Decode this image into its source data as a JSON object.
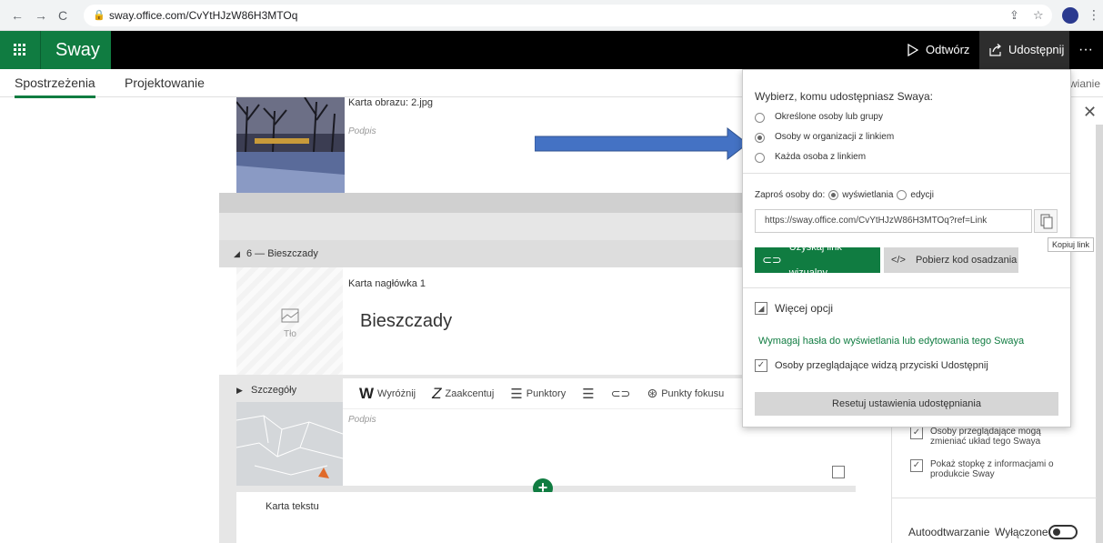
{
  "browser": {
    "url": "sway.office.com/CvYtHJzW86H3MTOq"
  },
  "app": {
    "name": "Sway",
    "play_label": "Odtwórz",
    "share_label": "Udostępnij",
    "more_label": "···"
  },
  "tabs": {
    "storyline": "Spostrzeżenia",
    "design": "Projektowanie",
    "right_partial": "wianie"
  },
  "cards": {
    "image_card_label": "Karta obrazu: 2.jpg",
    "image_caption": "Podpis",
    "section_title": "6 — Bieszczady",
    "heading_card_label": "Karta nagłówka 1",
    "heading_text": "Bieszczady",
    "bg_label": "Tło",
    "details_label": "Szczegóły",
    "map_caption": "Podpis",
    "text_card_label": "Karta tekstu"
  },
  "toolbar": {
    "emphasize": "Wyróżnij",
    "accent": "Zaakcentuj",
    "bullets": "Punktory",
    "focus": "Punkty fokusu",
    "emph_icon": "W",
    "accent_icon": "Z"
  },
  "share_popup": {
    "title": "Wybierz, komu udostępniasz Swaya:",
    "options": [
      "Określone osoby lub grupy",
      "Osoby w organizacji z linkiem",
      "Każda osoba z linkiem"
    ],
    "invite_prefix": "Zaproś osoby do:",
    "invite_view": "wyświetlania",
    "invite_edit": "edycji",
    "link_value": "https://sway.office.com/CvYtHJzW86H3MTOq?ref=Link",
    "visual_link_btn": "Uzyskaj link wizualny",
    "embed_btn": "Pobierz kod osadzania",
    "embed_icon": "</>",
    "more_options": "Więcej opcji",
    "password_link": "Wymagaj hasła do wyświetlania lub edytowania tego Swaya",
    "share_buttons_opt": "Osoby przeglądające widzą przyciski Udostępnij",
    "reset_btn": "Resetuj ustawienia udostępniania",
    "copy_tooltip": "Kopiuj link"
  },
  "right_panel": {
    "change_layout_opt": "Osoby przeglądające mogą zmieniać układ tego Swaya",
    "footer_opt": "Pokaż stopkę z informacjami o produkcie Sway",
    "autoplay_label": "Autoodtwarzanie",
    "autoplay_state": "Wyłączone"
  },
  "colors": {
    "brand": "#107c41",
    "arrow": "#4472c4"
  }
}
